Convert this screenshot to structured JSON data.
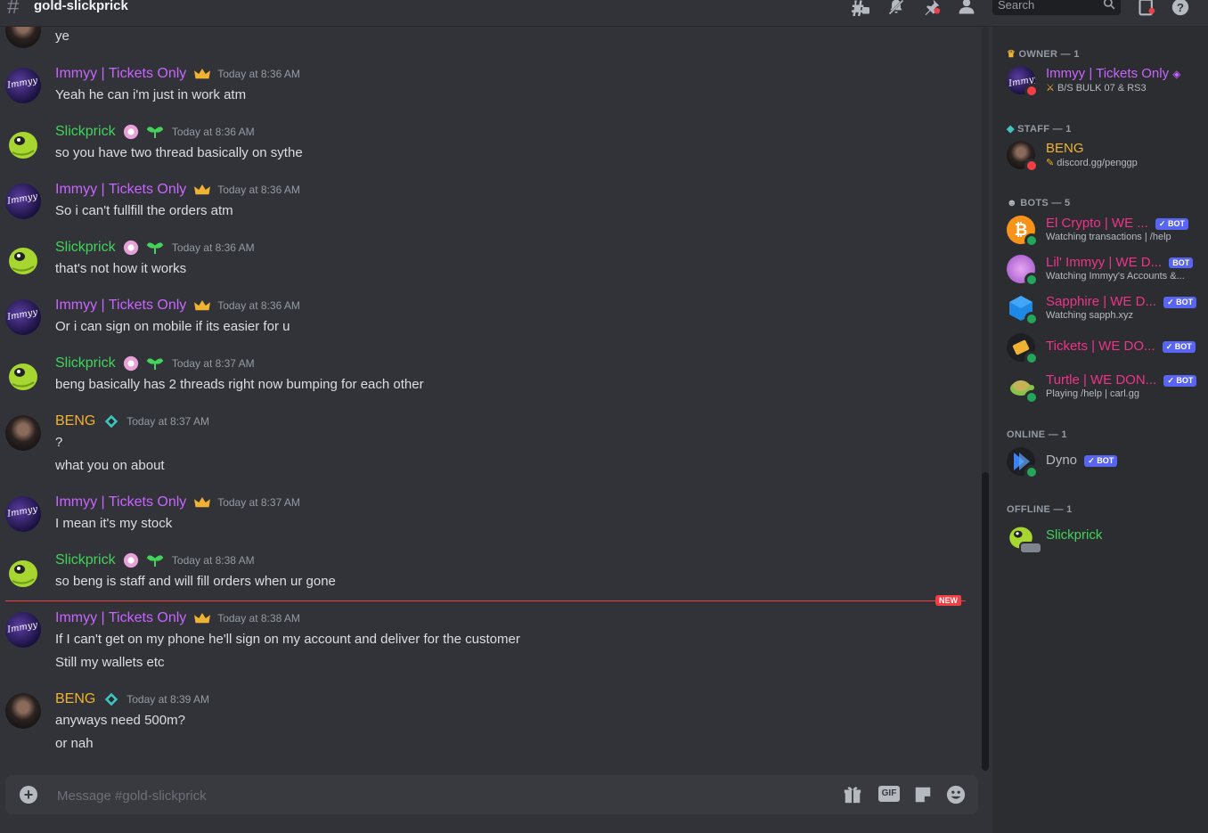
{
  "channel": {
    "name": "gold-slickprick"
  },
  "search": {
    "placeholder": "Search"
  },
  "messages": [
    {
      "author": "",
      "lines": [
        "ye"
      ]
    },
    {
      "author": "Immyy | Tickets Only",
      "time": "Today at 8:36 AM",
      "lines": [
        "Yeah he can i'm just in work atm"
      ]
    },
    {
      "author": "Slickprick",
      "time": "Today at 8:36 AM",
      "lines": [
        "so you have two thread basically on sythe"
      ]
    },
    {
      "author": "Immyy | Tickets Only",
      "time": "Today at 8:36 AM",
      "lines": [
        "So i can't fullfill the orders atm"
      ]
    },
    {
      "author": "Slickprick",
      "time": "Today at 8:36 AM",
      "lines": [
        "that's not how it works"
      ]
    },
    {
      "author": "Immyy | Tickets Only",
      "time": "Today at 8:36 AM",
      "lines": [
        "Or i can sign on mobile if its easier for u"
      ]
    },
    {
      "author": "Slickprick",
      "time": "Today at 8:37 AM",
      "lines": [
        "beng basically has 2 threads right now bumping for each other"
      ]
    },
    {
      "author": "BENG",
      "time": "Today at 8:37 AM",
      "lines": [
        "?",
        "what you on about"
      ]
    },
    {
      "author": "Immyy | Tickets Only",
      "time": "Today at 8:37 AM",
      "lines": [
        "I mean it's my stock"
      ]
    },
    {
      "author": "Slickprick",
      "time": "Today at 8:38 AM",
      "lines": [
        "so beng is staff and will fill orders when ur gone"
      ]
    },
    {
      "author": "Immyy | Tickets Only",
      "time": "Today at 8:38 AM",
      "lines": [
        "If I can't get on my phone he'll sign on my account and deliver for the customer",
        "Still my wallets etc"
      ]
    },
    {
      "author": "BENG",
      "time": "Today at 8:39 AM",
      "lines": [
        "anyways need 500m?",
        "or nah"
      ]
    }
  ],
  "new_divider": "NEW",
  "composer": {
    "placeholder": "Message #gold-slickprick",
    "gif_label": "GIF"
  },
  "members": {
    "owner_header": "OWNER — 1",
    "owner": {
      "name": "Immyy | Tickets Only",
      "sub": "B/S BULK 07 & RS3"
    },
    "staff_header": "STAFF — 1",
    "staff": {
      "name": "BENG",
      "sub": "discord.gg/penggp"
    },
    "bots_header": "BOTS — 5",
    "bots": [
      {
        "name": "El Crypto | WE ...",
        "sub": "Watching transactions | /help",
        "badge": "✓ BOT"
      },
      {
        "name": "Lil' Immyy | WE D...",
        "sub": "Watching Immyy's Accounts &...",
        "badge": "BOT"
      },
      {
        "name": "Sapphire | WE D...",
        "sub": "Watching sapph.xyz",
        "badge": "✓ BOT"
      },
      {
        "name": "Tickets | WE DO...",
        "sub": "",
        "badge": "✓ BOT"
      },
      {
        "name": "Turtle | WE DON...",
        "sub": "Playing /help | carl.gg",
        "badge": "✓ BOT"
      }
    ],
    "online_header": "ONLINE — 1",
    "online": {
      "name": "Dyno",
      "badge": "✓ BOT"
    },
    "offline_header": "OFFLINE — 1",
    "offline": {
      "name": "Slickprick"
    }
  },
  "colors": {
    "immyy": "#c864ff",
    "slickprick": "#43d35a",
    "beng": "#f0b232",
    "bot_names": "#f0338a",
    "bot_badge": "#5865f2",
    "new_line": "#f23f43"
  }
}
